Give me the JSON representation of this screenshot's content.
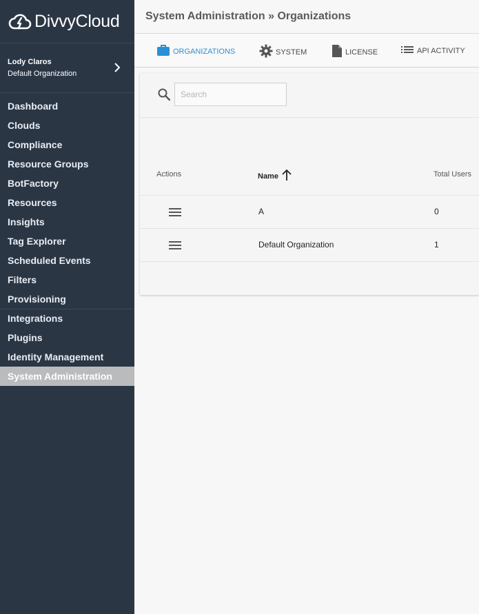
{
  "app": {
    "logo_text": "DivvyCloud"
  },
  "user": {
    "name": "Lody Claros",
    "organization": "Default Organization"
  },
  "nav": [
    {
      "label": "Dashboard",
      "name": "nav-dashboard"
    },
    {
      "label": "Clouds",
      "name": "nav-clouds"
    },
    {
      "label": "Compliance",
      "name": "nav-compliance"
    },
    {
      "label": "Resource Groups",
      "name": "nav-resource-groups"
    },
    {
      "label": "BotFactory",
      "name": "nav-botfactory"
    },
    {
      "label": "Resources",
      "name": "nav-resources"
    },
    {
      "label": "Insights",
      "name": "nav-insights"
    },
    {
      "label": "Tag Explorer",
      "name": "nav-tag-explorer"
    },
    {
      "label": "Scheduled Events",
      "name": "nav-scheduled-events"
    },
    {
      "label": "Filters",
      "name": "nav-filters"
    },
    {
      "label": "Provisioning",
      "name": "nav-provisioning"
    },
    {
      "label": "Integrations",
      "name": "nav-integrations"
    },
    {
      "label": "Plugins",
      "name": "nav-plugins"
    },
    {
      "label": "Identity Management",
      "name": "nav-identity-management"
    },
    {
      "label": "System Administration",
      "name": "nav-system-administration"
    }
  ],
  "header": {
    "title": "System Administration » Organizations"
  },
  "tabs": [
    {
      "label": "ORGANIZATIONS",
      "icon": "briefcase-icon",
      "active": true
    },
    {
      "label": "SYSTEM",
      "icon": "gear-icon",
      "active": false
    },
    {
      "label": "LICENSE",
      "icon": "document-icon",
      "active": false
    },
    {
      "label": "API ACTIVITY",
      "icon": "list-icon",
      "active": false
    }
  ],
  "search": {
    "placeholder": "Search",
    "value": ""
  },
  "table": {
    "columns": [
      "Actions",
      "Name",
      "Total Users"
    ],
    "sort": {
      "column": "Name",
      "direction": "ascending"
    },
    "rows": [
      {
        "name": "A",
        "total_users": "0"
      },
      {
        "name": "Default Organization",
        "total_users": "1"
      }
    ]
  },
  "colors": {
    "sidebar": "#2b3645",
    "accent": "#2a8fd6",
    "active_nav": "#b9bbbd"
  }
}
